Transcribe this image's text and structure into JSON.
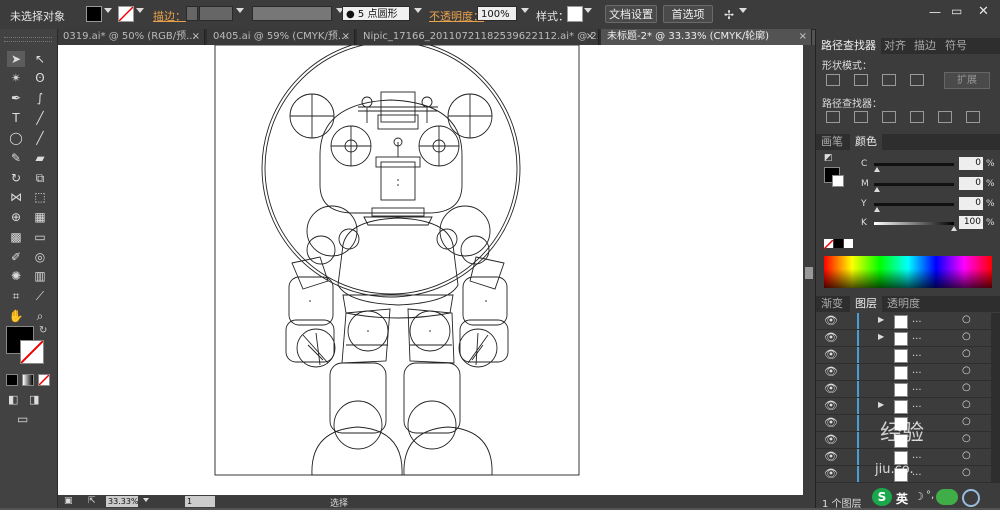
{
  "control_bar": {
    "selection_status": "未选择对象",
    "stroke_label": "描边：",
    "brush_label": "5 点圆形",
    "opacity_label": "不透明度：",
    "opacity_value": "100%",
    "style_label": "样式：",
    "doc_setup_button": "文档设置",
    "preferences_button": "首选项"
  },
  "tabs": [
    {
      "label": "0319.ai* @ 50% (RGB/预...",
      "active": false
    },
    {
      "label": "0405.ai @ 59% (CMYK/预...",
      "active": false
    },
    {
      "label": "Nipic_17166_20110721182539622112.ai* @ 2...",
      "active": false
    },
    {
      "label": "未标题-2* @ 33.33% (CMYK/轮廓)",
      "active": true
    }
  ],
  "pathfinder_panel": {
    "tabs": [
      "路径查找器",
      "对齐",
      "描边",
      "符号"
    ],
    "shape_modes_label": "形状模式：",
    "expand_button": "扩展",
    "pathfinders_label": "路径查找器："
  },
  "color_panel": {
    "tabs": [
      "画笔",
      "颜色"
    ],
    "channels": [
      {
        "name": "C",
        "value": "0",
        "unit": "%",
        "level": 0
      },
      {
        "name": "M",
        "value": "0",
        "unit": "%",
        "level": 0
      },
      {
        "name": "Y",
        "value": "0",
        "unit": "%",
        "level": 0
      },
      {
        "name": "K",
        "value": "100",
        "unit": "%",
        "level": 1
      }
    ]
  },
  "layers_panel": {
    "tabs": [
      "渐变",
      "图层",
      "透明度"
    ],
    "rows": [
      {
        "name": "...",
        "expanded": true
      },
      {
        "name": "...",
        "expanded": true
      },
      {
        "name": "...",
        "expanded": false
      },
      {
        "name": "...",
        "expanded": false
      },
      {
        "name": "...",
        "expanded": false
      },
      {
        "name": "...",
        "expanded": true
      },
      {
        "name": "...",
        "expanded": false
      },
      {
        "name": "...",
        "expanded": false
      },
      {
        "name": "...",
        "expanded": false
      },
      {
        "name": "...",
        "expanded": false
      }
    ],
    "footer_label": "1 个图层"
  },
  "status_bar": {
    "zoom": "33.33%",
    "page": "1",
    "tool": "选择"
  },
  "taskbar": {
    "ime_label": "英",
    "watermark_text": "经验",
    "watermark_sub": "jiu.co."
  },
  "colors": {
    "accent": "#4a9cd6",
    "panel_bg": "#3c3c3c",
    "canvas_bg": "#ffffff"
  }
}
